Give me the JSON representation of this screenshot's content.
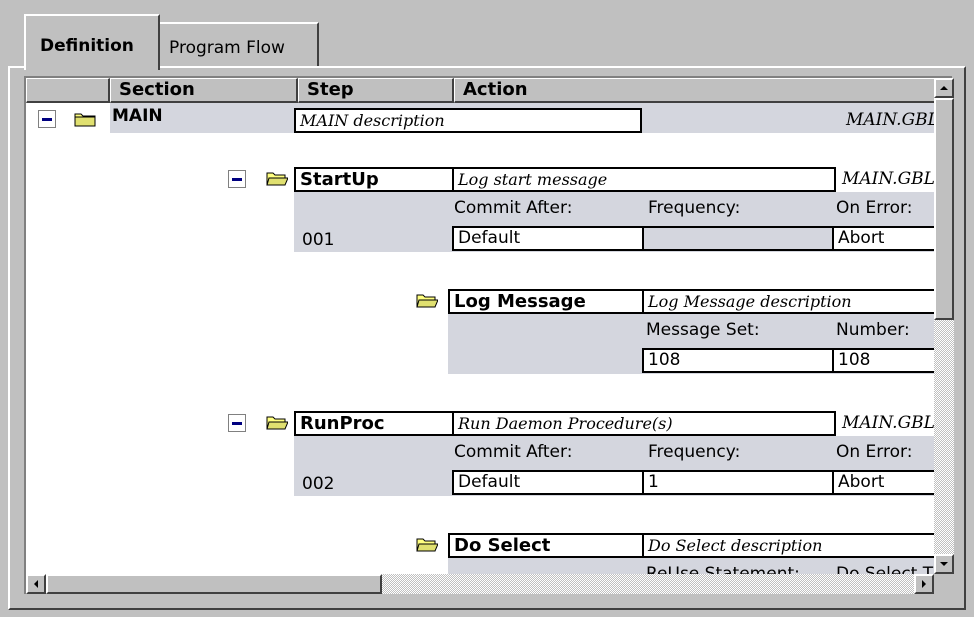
{
  "tabs": [
    {
      "label": "Definition",
      "active": true
    },
    {
      "label": "Program Flow",
      "active": false
    }
  ],
  "columns": [
    "Section",
    "Step",
    "Action"
  ],
  "main": {
    "name": "MAIN",
    "description": "MAIN description",
    "program": "MAIN.GBL"
  },
  "steps": [
    {
      "name": "StartUp",
      "description": "Log start message",
      "program": "MAIN.GBL",
      "number": "001",
      "labels": {
        "commit": "Commit After:",
        "frequency": "Frequency:",
        "on_error": "On Error:"
      },
      "values": {
        "commit": "Default",
        "frequency": "",
        "on_error": "Abort"
      },
      "action": {
        "name": "Log Message",
        "description": "Log Message description",
        "labels": {
          "set": "Message Set:",
          "number": "Number:"
        },
        "values": {
          "set": "108",
          "number": "108"
        }
      }
    },
    {
      "name": "RunProc",
      "description": "Run Daemon Procedure(s)",
      "program": "MAIN.GBL",
      "number": "002",
      "labels": {
        "commit": "Commit After:",
        "frequency": "Frequency:",
        "on_error": "On Error:"
      },
      "values": {
        "commit": "Default",
        "frequency": "1",
        "on_error": "Abort"
      },
      "action": {
        "name": "Do Select",
        "description": "Do Select description",
        "labels": {
          "reuse": "ReUse Statement:",
          "type": "Do Select T"
        }
      }
    }
  ],
  "icons": {
    "folder": "folder-icon",
    "collapse": "collapse-minus-icon",
    "scroll_up": "up-arrow-icon",
    "scroll_down": "down-arrow-icon",
    "scroll_left": "left-arrow-icon",
    "scroll_right": "right-arrow-icon"
  },
  "colors": {
    "row_gray": "#d4d6de",
    "collapse_minus": "#000080",
    "folder": "#ffff80"
  }
}
